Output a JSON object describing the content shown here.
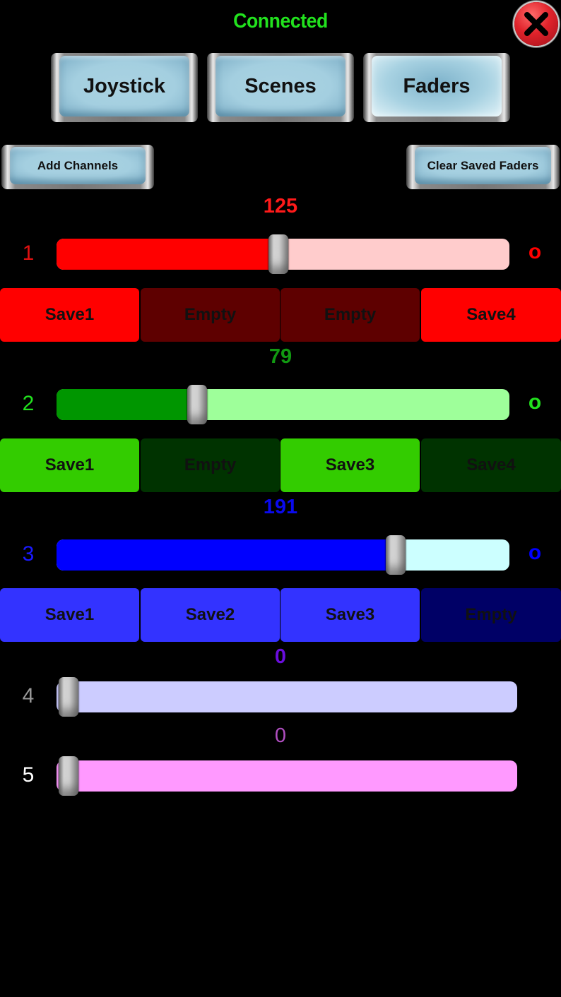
{
  "status": {
    "text": "Connected",
    "color": "#22e21e"
  },
  "close_button": {
    "icon": "close-x-icon",
    "color": "#e0232b"
  },
  "tabs": [
    {
      "label": "Joystick",
      "active": false
    },
    {
      "label": "Scenes",
      "active": false
    },
    {
      "label": "Faders",
      "active": true
    }
  ],
  "actions": {
    "add_channels": "Add Channels",
    "clear_saved_faders": "Clear Saved Faders"
  },
  "slider_range": {
    "min": 0,
    "max": 255
  },
  "channels": [
    {
      "number": "1",
      "value": 125,
      "value_label": "125",
      "zero_label": "o",
      "colors": {
        "text": "#ff1a1a",
        "fill": "#ff0000",
        "track": "#ffcccc",
        "number": "#e01010",
        "scene_on": "#ff0000",
        "scene_off": "#5e0000"
      },
      "scenes": [
        {
          "label": "Save1",
          "saved": true
        },
        {
          "label": "Empty",
          "saved": false
        },
        {
          "label": "Empty",
          "saved": false
        },
        {
          "label": "Save4",
          "saved": true
        }
      ]
    },
    {
      "number": "2",
      "value": 79,
      "value_label": "79",
      "zero_label": "o",
      "colors": {
        "text": "#119911",
        "fill": "#009600",
        "track": "#9eff9a",
        "number": "#22e21e",
        "scene_on": "#33cc00",
        "scene_off": "#003300"
      },
      "scenes": [
        {
          "label": "Save1",
          "saved": true
        },
        {
          "label": "Empty",
          "saved": false
        },
        {
          "label": "Save3",
          "saved": true
        },
        {
          "label": "Save4",
          "saved": false
        }
      ]
    },
    {
      "number": "3",
      "value": 191,
      "value_label": "191",
      "zero_label": "o",
      "colors": {
        "text": "#0a0aee",
        "fill": "#0000ff",
        "track": "#ccffff",
        "number": "#1a1aff",
        "scene_on": "#3333ff",
        "scene_off": "#000066"
      },
      "scenes": [
        {
          "label": "Save1",
          "saved": true
        },
        {
          "label": "Save2",
          "saved": true
        },
        {
          "label": "Save3",
          "saved": true
        },
        {
          "label": "Empty",
          "saved": false
        }
      ]
    },
    {
      "number": "4",
      "value": 0,
      "value_label": "0",
      "colors": {
        "text": "#6a0ddd",
        "fill": "#ccccff",
        "track": "#ccccff",
        "number": "#999999"
      },
      "scenes": []
    },
    {
      "number": "5",
      "value": 0,
      "value_label": "0",
      "colors": {
        "text": "#b04ec0",
        "fill": "#ff99ff",
        "track": "#ff99ff",
        "number": "#ffffff"
      },
      "scenes": []
    }
  ]
}
